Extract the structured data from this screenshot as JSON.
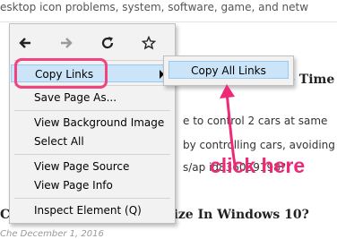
{
  "page": {
    "top_line": "esktop icon problems, system, software, game, and netw",
    "heading1": "e Time",
    "para1": "e to control 2 cars at same",
    "para2": "by controlling cars, avoiding",
    "para3": "s/ap                    id836039198?r",
    "heading2": "Change Mouse Pointer Size In Windows 10?",
    "byline": "Che              December 1, 2016"
  },
  "menu": {
    "nav": [
      "back-icon",
      "forward-icon",
      "reload-icon",
      "bookmark-star-icon"
    ],
    "items": [
      "Copy Links",
      "Save Page As...",
      "View Background Image",
      "Select All",
      "View Page Source",
      "View Page Info",
      "Inspect Element (Q)"
    ],
    "submenu_items": [
      "Copy All Links"
    ]
  },
  "annotation": {
    "text": "click here",
    "color": "#ee2a78"
  }
}
